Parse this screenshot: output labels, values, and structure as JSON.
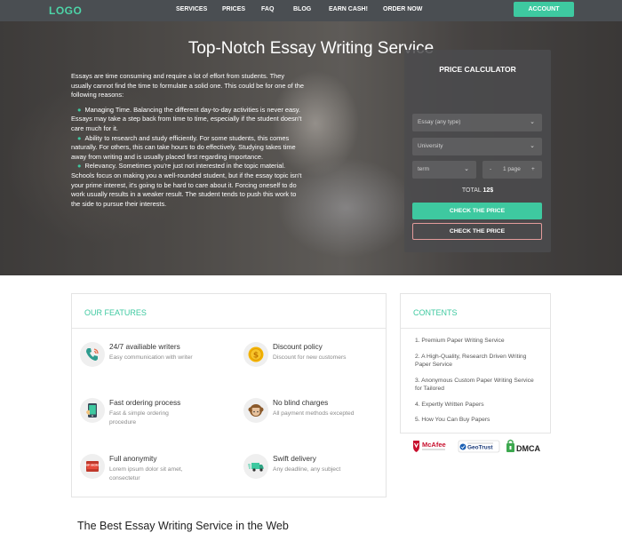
{
  "nav": {
    "logo": "LOGO",
    "links": [
      "SERVICES",
      "PRICES",
      "FAQ",
      "BLOG",
      "EARN CASH!",
      "ORDER NOW"
    ],
    "account": "ACCOUNT"
  },
  "hero": {
    "title": "Top-Notch Essay Writing Service",
    "intro": "Essays are time consuming and require a lot of effort from students. They usually cannot find the time to formulate a solid one. This could be for one of the following reasons:",
    "reasons": [
      "Managing Time. Balancing the different day-to-day activities is never easy. Essays may take a step back from time to time, especially if the student doesn't care much for it.",
      "Ability to research and study efficiently. For some students, this comes naturally. For others, this can take hours to do effectively. Studying takes time away from writing and is usually placed first regarding importance.",
      "Relevancy. Sometimes you're just not interested in the topic material. Schools focus on making you a well-rounded student, but if the essay topic isn't your prime interest, it's going to be hard to care about it. Forcing oneself to do work usually results in a weaker result. The student tends to push this work to the side to pursue their interests."
    ]
  },
  "calculator": {
    "title": "PRICE CALCULATOR",
    "type_select": "Essay (any type)",
    "level_select": "University",
    "term_select": "term",
    "minus": "-",
    "pages": "1 page",
    "plus": "+",
    "total_label": "TOTAL",
    "total_value": "12$",
    "check_primary": "CHECK THE PRICE",
    "check_secondary": "CHECK THE PRICE"
  },
  "features": {
    "title": "OUR FEATURES",
    "items": [
      {
        "title": "24/7 availiable writers",
        "desc": "Easy communication with writer",
        "icon": "phone-icon"
      },
      {
        "title": "Discount policy",
        "desc": "Discount for new customers",
        "icon": "coin-icon"
      },
      {
        "title": "Fast ordering process",
        "desc": "Fast & simple ordering procedure",
        "icon": "mobile-icon"
      },
      {
        "title": "No blind charges",
        "desc": "All payment methods excepted",
        "icon": "monkey-icon"
      },
      {
        "title": "Full anonymity",
        "desc": "Lorem ipsum dolor sit amet, consectetur",
        "icon": "top-secret-icon"
      },
      {
        "title": "Swift delivery",
        "desc": "Any deadline, any subject",
        "icon": "truck-icon"
      }
    ],
    "top_secret_text": "TOP SECRET"
  },
  "contents": {
    "title": "CONTENTS",
    "items": [
      "1. Premium Paper Writing Service",
      "2. A High-Quality, Research Driven Writing Paper Service",
      "3. Anonymous Custom Paper Writing Service for Tailored",
      "4. Expertly Written Papers",
      "5. How You Can Buy Papers"
    ]
  },
  "badges": {
    "mcafee": "McAfee",
    "geotrust": "GeoTrust",
    "dmca": "DMCA"
  },
  "bottom_heading": "The Best Essay Writing Service in the Web",
  "colors": {
    "accent": "#3ec9a0",
    "nav_bg": "#4a4e52",
    "outline": "#e39b9b"
  }
}
